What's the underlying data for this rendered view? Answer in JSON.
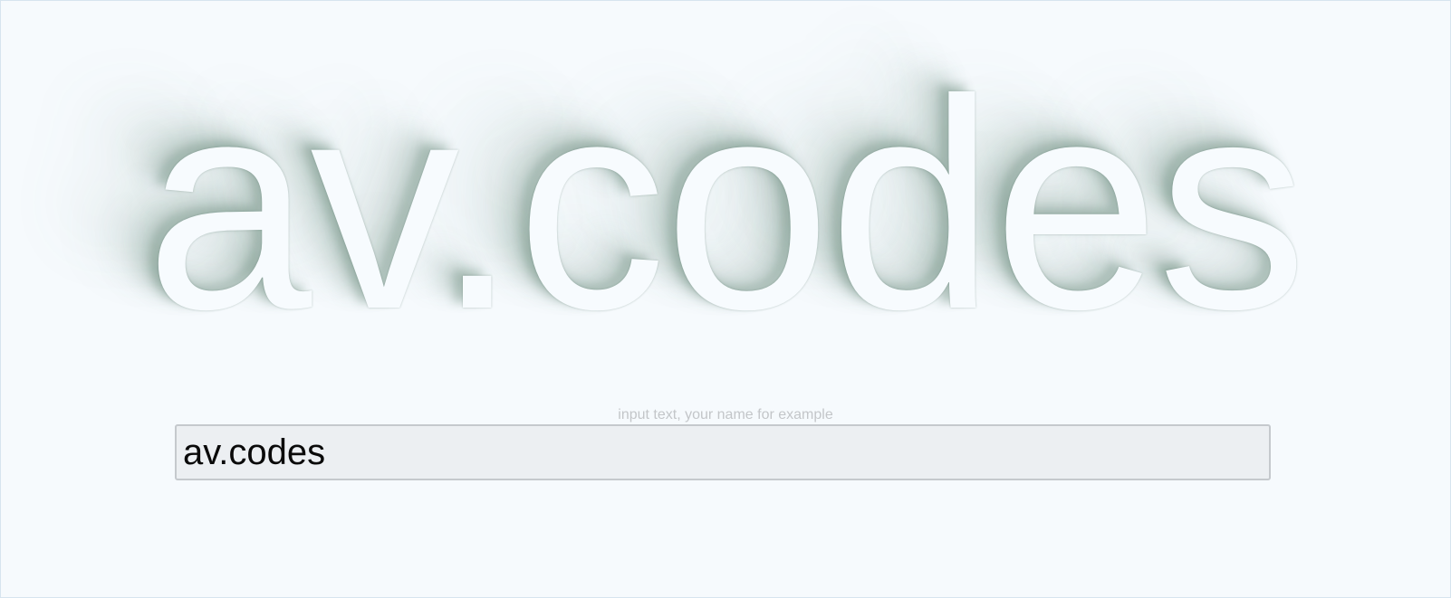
{
  "headline": {
    "text": "av.codes"
  },
  "form": {
    "hint": "input text, your name for example",
    "input_value": "av.codes"
  },
  "colors": {
    "background": "#f6fafd",
    "shadow": "#466e5a",
    "input_background": "#eceff2",
    "input_border": "#c5c9cd"
  }
}
